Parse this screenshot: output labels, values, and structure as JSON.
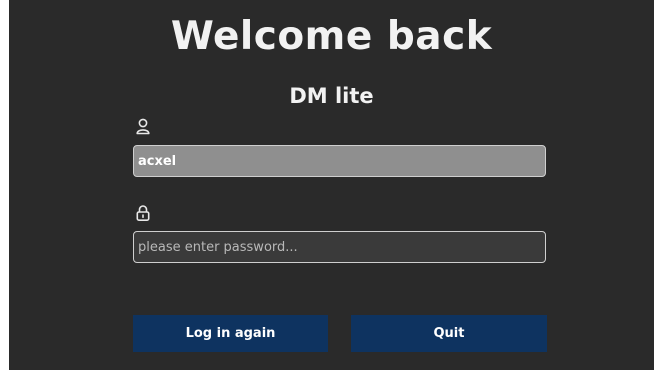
{
  "header": {
    "title": "Welcome back",
    "app_name": "DM lite"
  },
  "form": {
    "username_icon": "user-icon",
    "username_value": "acxel",
    "password_icon": "lock-icon",
    "password_value": "",
    "password_placeholder": "please enter password..."
  },
  "actions": {
    "login_label": "Log in again",
    "quit_label": "Quit"
  },
  "colors": {
    "background": "#2a2a2a",
    "button": "#0e3360",
    "username_field": "#8f8f8f"
  }
}
